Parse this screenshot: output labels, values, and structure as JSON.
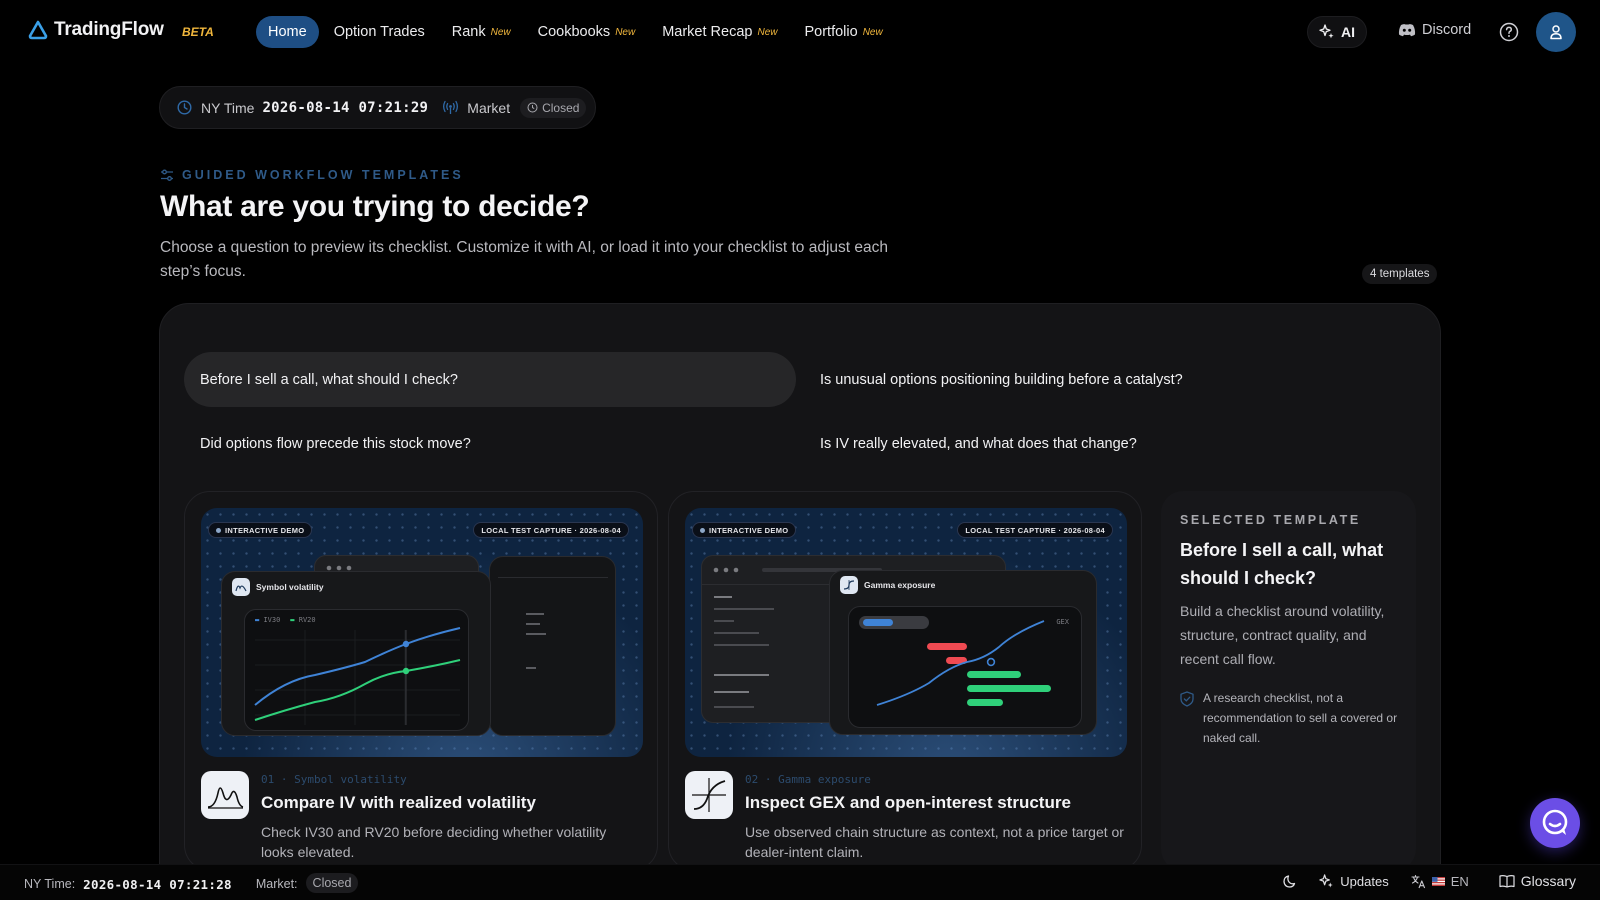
{
  "brand": {
    "name": "TradingFlow",
    "beta_label": "BETA"
  },
  "nav": {
    "items": [
      {
        "label": "Home",
        "badge": ""
      },
      {
        "label": "Option Trades",
        "badge": ""
      },
      {
        "label": "Rank",
        "badge": "New"
      },
      {
        "label": "Cookbooks",
        "badge": "New"
      },
      {
        "label": "Market Recap",
        "badge": "New"
      },
      {
        "label": "Portfolio",
        "badge": "New"
      }
    ],
    "ai_label": "AI",
    "discord_label": "Discord"
  },
  "clock": {
    "label": "NY Time",
    "datetime": "2026-08-14 07:21:29",
    "market_label": "Market",
    "market_status": "Closed"
  },
  "hero": {
    "eyebrow": "GUIDED WORKFLOW TEMPLATES",
    "title": "What are you trying to decide?",
    "subtitle": "Choose a question to preview its checklist. Customize it with AI, or load it into your checklist to adjust each step’s focus.",
    "template_count": "4 templates"
  },
  "questions": [
    "Before I sell a call, what should I check?",
    "Is unusual options positioning building before a catalyst?",
    "Did options flow precede this stock move?",
    "Is IV really elevated, and what does that change?"
  ],
  "cards": [
    {
      "demo_tag": "INTERACTIVE DEMO",
      "capture_tag": "LOCAL TEST CAPTURE · 2026-08-04",
      "window_title": "Symbol volatility",
      "legend": [
        "IV30",
        "RV20"
      ],
      "kicker": "01 · Symbol volatility",
      "title": "Compare IV with realized volatility",
      "desc": "Check IV30 and RV20 before deciding whether volatility looks elevated."
    },
    {
      "demo_tag": "INTERACTIVE DEMO",
      "capture_tag": "LOCAL TEST CAPTURE · 2026-08-04",
      "window_title": "Gamma exposure",
      "side_label": "GEX",
      "kicker": "02 · Gamma exposure",
      "title": "Inspect GEX and open-interest structure",
      "desc": "Use observed chain structure as context, not a price target or dealer-intent claim."
    }
  ],
  "selected": {
    "eyebrow": "SELECTED TEMPLATE",
    "title": "Before I sell a call, what should I check?",
    "desc": "Build a checklist around volatility, structure, contract quality, and recent call flow.",
    "note": "A research checklist, not a recommendation to sell a covered or naked call."
  },
  "statusbar": {
    "time_label": "NY Time:",
    "time_value": "2026-08-14 07:21:28",
    "market_label": "Market:",
    "market_status": "Closed",
    "updates_label": "Updates",
    "lang_label": "EN",
    "glossary_label": "Glossary"
  },
  "colors": {
    "accent": "#1e4e84",
    "new_badge": "#f0b63c",
    "iv_line": "#3f83d6",
    "rv_line": "#2fd07a",
    "chat_fab": "#6b4ee6"
  }
}
